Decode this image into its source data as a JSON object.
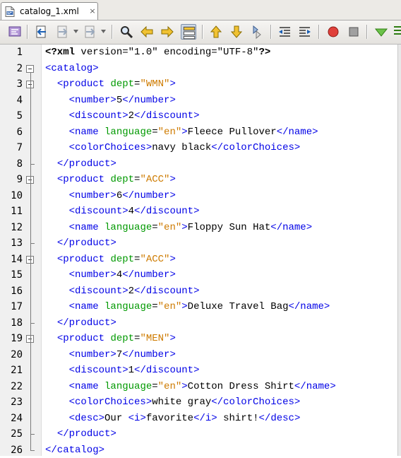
{
  "tab": {
    "title": "catalog_1.xml",
    "icon": "xml-file-icon",
    "close_glyph": "×"
  },
  "toolbar": {
    "buttons": [
      "source-history-icon",
      "back-icon",
      "forward-icon",
      "navigate-icon",
      "find-icon",
      "find-previous-icon",
      "find-next-icon",
      "toggle-highlight-icon",
      "previous-bookmark-icon",
      "next-bookmark-icon",
      "toggle-bookmark-icon",
      "shift-left-icon",
      "shift-right-icon",
      "start-macro-icon",
      "stop-macro-icon",
      "validate-icon"
    ]
  },
  "editor": {
    "lines": [
      {
        "n": "1",
        "code": "<?xml version=\"1.0\" encoding=\"UTF-8\"?>"
      },
      {
        "n": "2",
        "code": "<catalog>"
      },
      {
        "n": "3",
        "code": "  <product dept=\"WMN\">"
      },
      {
        "n": "4",
        "code": "    <number>5</number>"
      },
      {
        "n": "5",
        "code": "    <discount>2</discount>"
      },
      {
        "n": "6",
        "code": "    <name language=\"en\">Fleece Pullover</name>"
      },
      {
        "n": "7",
        "code": "    <colorChoices>navy black</colorChoices>"
      },
      {
        "n": "8",
        "code": "  </product>"
      },
      {
        "n": "9",
        "code": "  <product dept=\"ACC\">"
      },
      {
        "n": "10",
        "code": "    <number>6</number>"
      },
      {
        "n": "11",
        "code": "    <discount>4</discount>"
      },
      {
        "n": "12",
        "code": "    <name language=\"en\">Floppy Sun Hat</name>"
      },
      {
        "n": "13",
        "code": "  </product>"
      },
      {
        "n": "14",
        "code": "  <product dept=\"ACC\">"
      },
      {
        "n": "15",
        "code": "    <number>4</number>"
      },
      {
        "n": "16",
        "code": "    <discount>2</discount>"
      },
      {
        "n": "17",
        "code": "    <name language=\"en\">Deluxe Travel Bag</name>"
      },
      {
        "n": "18",
        "code": "  </product>"
      },
      {
        "n": "19",
        "code": "  <product dept=\"MEN\">"
      },
      {
        "n": "20",
        "code": "    <number>7</number>"
      },
      {
        "n": "21",
        "code": "    <discount>1</discount>"
      },
      {
        "n": "22",
        "code": "    <name language=\"en\">Cotton Dress Shirt</name>"
      },
      {
        "n": "23",
        "code": "    <colorChoices>white gray</colorChoices>"
      },
      {
        "n": "24",
        "code": "    <desc>Our <i>favorite</i> shirt!</desc>"
      },
      {
        "n": "25",
        "code": "  </product>"
      },
      {
        "n": "26",
        "code": "</catalog>"
      }
    ]
  },
  "colors": {
    "tag": "#0000e6",
    "attribute": "#009900",
    "value": "#ce7b00",
    "text": "#000000"
  }
}
